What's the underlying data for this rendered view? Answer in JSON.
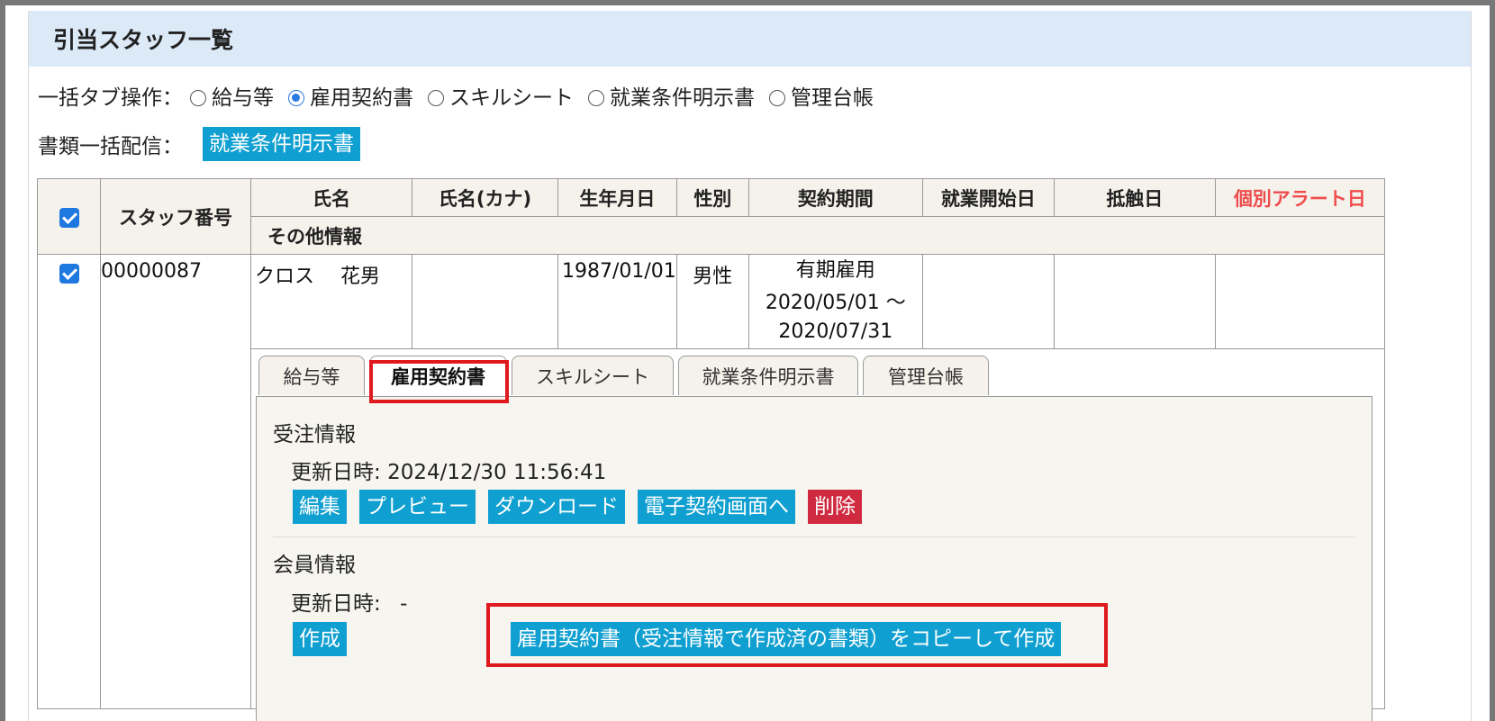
{
  "panel": {
    "title": "引当スタッフ一覧"
  },
  "bulk_tab": {
    "label": "一括タブ操作：",
    "options": [
      "給与等",
      "雇用契約書",
      "スキルシート",
      "就業条件明示書",
      "管理台帳"
    ],
    "selected": "雇用契約書"
  },
  "bulk_send": {
    "label": "書類一括配信：",
    "button": "就業条件明示書"
  },
  "table": {
    "headers": {
      "staff_no": "スタッフ番号",
      "name": "氏名",
      "name_kana": "氏名(カナ)",
      "birth": "生年月日",
      "gender": "性別",
      "contract_period": "契約期間",
      "start_date": "就業開始日",
      "conflict_date": "抵触日",
      "alert_date": "個別アラート日",
      "other_info": "その他情報"
    },
    "header_checked": true,
    "row": {
      "checked": true,
      "staff_no": "00000087",
      "name": "クロス　 花男",
      "name_kana": "",
      "birth": "1987/01/01",
      "gender": "男性",
      "contract_type": "有期雇用",
      "contract_from": "2020/05/01 ～",
      "contract_to": "2020/07/31",
      "start_date": "",
      "conflict_date": "",
      "alert_date": ""
    }
  },
  "tabs": {
    "items": [
      "給与等",
      "雇用契約書",
      "スキルシート",
      "就業条件明示書",
      "管理台帳"
    ],
    "active": "雇用契約書"
  },
  "order_info": {
    "title": "受注情報",
    "updated_label": "更新日時:",
    "updated_value": "2024/12/30 11:56:41",
    "buttons": {
      "edit": "編集",
      "preview": "プレビュー",
      "download": "ダウンロード",
      "esign": "電子契約画面へ",
      "delete": "削除"
    }
  },
  "member_info": {
    "title": "会員情報",
    "updated_label": "更新日時:",
    "updated_value": "-",
    "buttons": {
      "create": "作成",
      "copy_create": "雇用契約書（受注情報で作成済の書類）をコピーして作成"
    }
  },
  "colors": {
    "button": "#0f9fd0",
    "delete": "#cf2a3f",
    "header_bg": "#dce9f7",
    "highlight": "#e0191e",
    "alert_text": "#ef4d4d"
  }
}
